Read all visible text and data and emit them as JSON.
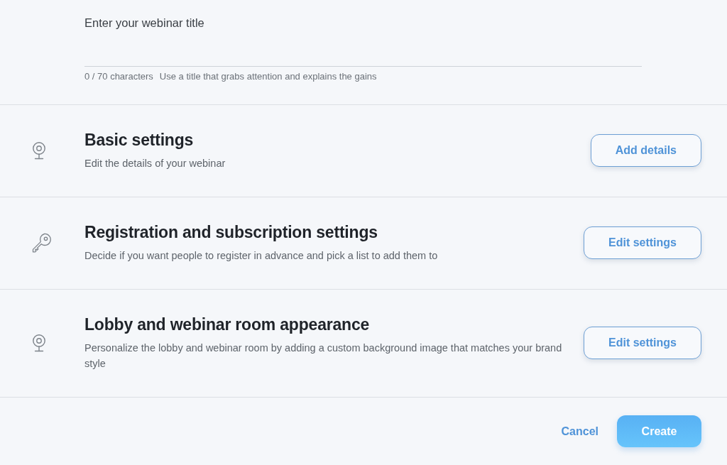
{
  "title_field": {
    "placeholder": "Enter your webinar title",
    "counter": "0 / 70 characters",
    "hint": "Use a title that grabs attention and explains the gains"
  },
  "sections": [
    {
      "kind": "webcam",
      "title": "Basic settings",
      "description": "Edit the details of your webinar",
      "button": "Add details"
    },
    {
      "kind": "key",
      "title": "Registration and subscription settings",
      "description": "Decide if you want people to register in advance and pick a list to add them to",
      "button": "Edit settings"
    },
    {
      "kind": "webcam",
      "title": "Lobby and webinar room appearance",
      "description": "Personalize the lobby and webinar room by adding a custom background image that matches your brand style",
      "button": "Edit settings"
    }
  ],
  "footer": {
    "cancel": "Cancel",
    "create": "Create"
  }
}
